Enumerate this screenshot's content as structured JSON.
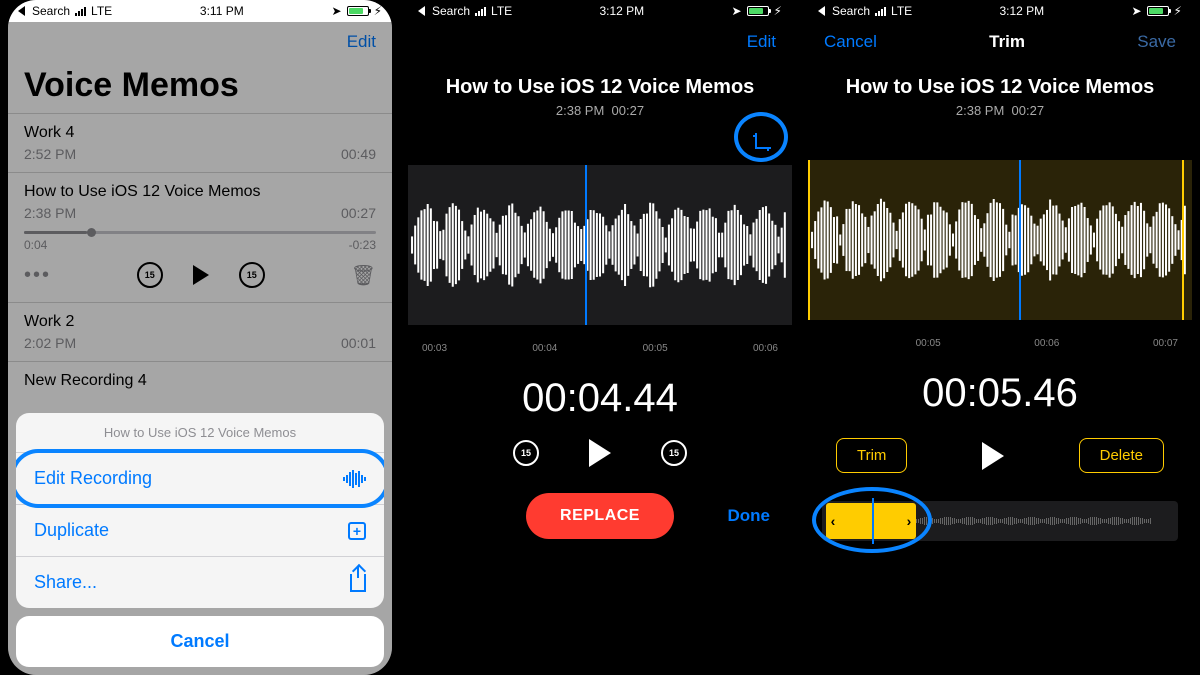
{
  "statusbar": {
    "back_text": "Search",
    "carrier": "LTE",
    "time1": "3:11 PM",
    "time2": "3:12 PM",
    "time3": "3:12 PM"
  },
  "screen1": {
    "edit": "Edit",
    "title": "Voice Memos",
    "items": [
      {
        "name": "Work 4",
        "time": "2:52 PM",
        "dur": "00:49"
      },
      {
        "name": "How to Use iOS 12 Voice Memos",
        "time": "2:38 PM",
        "dur": "00:27"
      }
    ],
    "expanded": {
      "pos": "0:04",
      "rem": "-0:23",
      "skip_amt": "15"
    },
    "lower_items": [
      {
        "name": "Work 2",
        "time": "2:02 PM",
        "dur": "00:01"
      },
      {
        "name": "New Recording 4",
        "time": "",
        "dur": ""
      }
    ],
    "sheet": {
      "header": "How to Use iOS 12 Voice Memos",
      "edit_recording": "Edit Recording",
      "duplicate": "Duplicate",
      "share": "Share...",
      "cancel": "Cancel"
    }
  },
  "screen2": {
    "nav_edit": "Edit",
    "title": "How to Use iOS 12 Voice Memos",
    "subtitle_time": "2:38 PM",
    "subtitle_dur": "00:27",
    "ticks": [
      "00:03",
      "00:04",
      "00:05",
      "00:06"
    ],
    "big_time": "00:04.44",
    "skip_amt": "15",
    "replace": "REPLACE",
    "done": "Done"
  },
  "screen3": {
    "cancel": "Cancel",
    "title_nav": "Trim",
    "save": "Save",
    "title": "How to Use iOS 12 Voice Memos",
    "subtitle_time": "2:38 PM",
    "subtitle_dur": "00:27",
    "ticks": [
      "",
      "00:05",
      "00:06",
      "00:07"
    ],
    "big_time": "00:05.46",
    "trim_btn": "Trim",
    "delete_btn": "Delete"
  },
  "colors": {
    "accent": "#007aff",
    "red": "#ff3b30",
    "yellow": "#ffcc00"
  }
}
